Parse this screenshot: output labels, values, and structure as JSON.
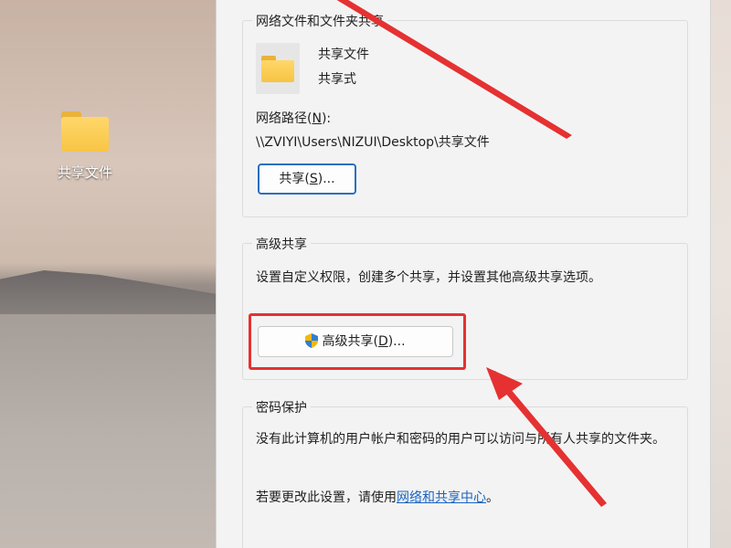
{
  "desktop": {
    "icon_label": "共享文件"
  },
  "sharing_group": {
    "legend": "网络文件和文件夹共享",
    "folder_name": "共享文件",
    "folder_status": "共享式",
    "network_path_label_prefix": "网络路径(",
    "network_path_label_key": "N",
    "network_path_label_suffix": "):",
    "network_path": "\\\\ZVIYI\\Users\\NIZUI\\Desktop\\共享文件",
    "share_button_prefix": "共享(",
    "share_button_key": "S",
    "share_button_suffix": ")..."
  },
  "advanced_group": {
    "legend": "高级共享",
    "description": "设置自定义权限，创建多个共享，并设置其他高级共享选项。",
    "button_prefix": "高级共享(",
    "button_key": "D",
    "button_suffix": ")..."
  },
  "password_group": {
    "legend": "密码保护",
    "description": "没有此计算机的用户帐户和密码的用户可以访问与所有人共享的文件夹。",
    "change_prefix": "若要更改此设置，请使用",
    "change_link": "网络和共享中心",
    "change_suffix": "。"
  },
  "colors": {
    "highlight_border": "#e53131",
    "arrow": "#e53131",
    "link": "#1a64c2",
    "focus_border": "#2b6fbf"
  },
  "icons": [
    "folder-icon",
    "shield-icon"
  ]
}
